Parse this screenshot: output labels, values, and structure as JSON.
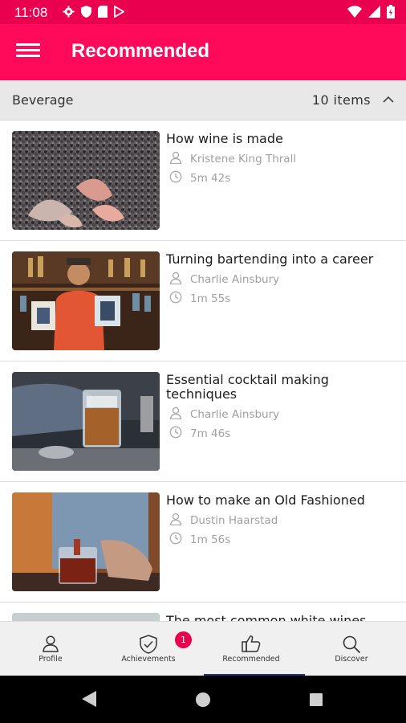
{
  "status_bar": {
    "time": "11:08",
    "left_icons": [
      "gear-icon",
      "shield-icon",
      "sd-card-icon",
      "play-store-icon"
    ],
    "right_icons": [
      "wifi-icon",
      "signal-icon",
      "battery-icon"
    ]
  },
  "app_bar": {
    "title": "Recommended",
    "menu_icon": "hamburger-menu-icon",
    "color": "#FF0A5B"
  },
  "section": {
    "title": "Beverage",
    "count": "10 items",
    "toggle_icon": "chevron-up-icon"
  },
  "videos": [
    {
      "title": "How wine is made",
      "author": "Kristene King Thrall",
      "duration": "5m 42s"
    },
    {
      "title": "Turning bartending into a career",
      "author": "Charlie Ainsbury",
      "duration": "1m 55s"
    },
    {
      "title": "Essential cocktail making techniques",
      "author": "Charlie Ainsbury",
      "duration": "7m 46s"
    },
    {
      "title": "How to make an Old Fashioned",
      "author": "Dustin Haarstad",
      "duration": "1m 56s"
    },
    {
      "title": "The most common white wines",
      "author": "",
      "duration": ""
    }
  ],
  "bottom_nav": {
    "items": [
      {
        "label": "Profile",
        "icon": "person-icon"
      },
      {
        "label": "Achievements",
        "icon": "shield-check-icon"
      },
      {
        "label": "Recommended",
        "icon": "thumbs-up-icon"
      },
      {
        "label": "Discover",
        "icon": "search-icon"
      }
    ],
    "active": "Recommended",
    "achievements_badge": "1",
    "active_color": "#24327e"
  },
  "system_nav": {
    "icons": [
      "back-icon",
      "home-icon",
      "recents-icon"
    ]
  }
}
